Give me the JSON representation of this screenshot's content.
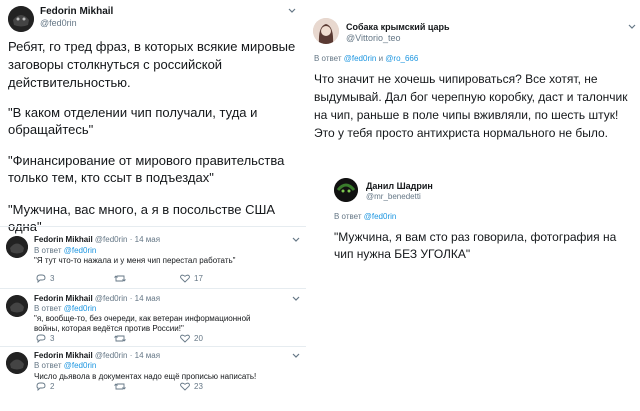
{
  "left": {
    "main_tweet": {
      "author_name": "Fedorin Mikhail",
      "author_handle": "@fed0rin",
      "text_intro": "Ребят, го тред фраз, в которых всякие мировые заговоры столкнуться с российской действительностью.",
      "quote1": "\"В каком отделении чип получали, туда и обращайтесь\"",
      "quote2": "\"Финансирование от мирового правительства только тем, кто ссыт в подъездах\"",
      "quote3": "\"Мужчина, вас много, а я в посольстве США одна\""
    },
    "replies": [
      {
        "author_name": "Fedorin Mikhail",
        "author_handle": "@fed0rin",
        "date": "14 мая",
        "reply_prefix": "В ответ",
        "reply_to": "@fed0rin",
        "text": "\"Я тут что-то нажала и у меня чип перестал работать\"",
        "replies_count": "3",
        "likes_count": "17"
      },
      {
        "author_name": "Fedorin Mikhail",
        "author_handle": "@fed0rin",
        "date": "14 мая",
        "reply_prefix": "В ответ",
        "reply_to": "@fed0rin",
        "text": "\"я, вообще-то, без очереди, как ветеран информационной войны, которая ведётся против России!\"",
        "replies_count": "3",
        "likes_count": "20"
      },
      {
        "author_name": "Fedorin Mikhail",
        "author_handle": "@fed0rin",
        "date": "14 мая",
        "reply_prefix": "В ответ",
        "reply_to": "@fed0rin",
        "text": "Число дьявола в документах надо ещё прописью написать!",
        "replies_count": "2",
        "likes_count": "23"
      }
    ]
  },
  "right": {
    "tweet1": {
      "author_name": "Собака крымский царь",
      "author_handle": "@Vittorio_teo",
      "reply_prefix": "В ответ",
      "reply_to_1": "@fed0rin",
      "reply_and": "и",
      "reply_to_2": "@ro_666",
      "text": "Что значит не хочешь чипироваться? Все хотят, не выдумывай. Дал бог черепную коробку, даст и талончик на чип, раньше в поле чипы вживляли, по шесть штук! Это у тебя просто антихриста нормального не было."
    },
    "tweet2": {
      "author_name": "Данил Шадрин",
      "author_handle": "@mr_benedetti",
      "reply_prefix": "В ответ",
      "reply_to": "@fed0rin",
      "text": "\"Мужчина, я вам сто раз говорила, фотография на чип нужна БЕЗ УГОЛКА\""
    }
  },
  "colors": {
    "link": "#1b95e0",
    "muted": "#657786",
    "text": "#14171a",
    "separator": "#e6ecf0"
  },
  "icons": [
    "chevron-down-icon",
    "reply-icon",
    "retweet-icon",
    "like-icon"
  ]
}
